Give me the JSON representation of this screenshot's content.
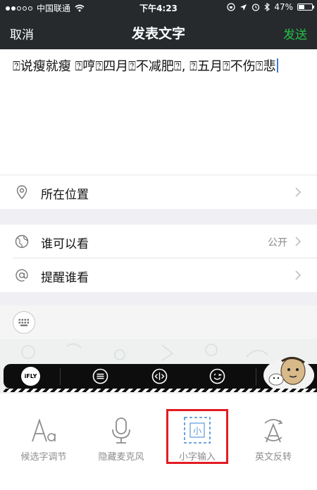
{
  "status_bar": {
    "carrier": "中国联通",
    "time": "下午4:23",
    "battery_percent_text": "47%",
    "battery_level": 0.47
  },
  "nav": {
    "cancel": "取消",
    "title": "发表文字",
    "send": "发送",
    "send_color": "#23c147"
  },
  "post": {
    "text": "⍰说瘦就瘦 ⍰哼⍰四月⍰不减肥⍰, ⍰五月⍰不伤⍰悲"
  },
  "rows": {
    "location": {
      "label": "所在位置",
      "icon": "location-pin-icon"
    },
    "visibility": {
      "label": "谁可以看",
      "value": "公开",
      "icon": "globe-icon"
    },
    "remind": {
      "label": "提醒谁看",
      "icon": "at-icon"
    }
  },
  "ifly": {
    "logo_text": "iFLY",
    "buttons": [
      "list-icon",
      "cursor-move-icon",
      "emoji-icon"
    ]
  },
  "toolbar": {
    "items": [
      {
        "label": "候选字调节",
        "icon": "font-size-icon"
      },
      {
        "label": "隐藏麦克风",
        "icon": "microphone-icon"
      },
      {
        "label": "小字输入",
        "icon": "small-char-icon"
      },
      {
        "label": "英文反转",
        "icon": "english-reverse-icon"
      }
    ],
    "highlight_color": "#e21b23"
  }
}
